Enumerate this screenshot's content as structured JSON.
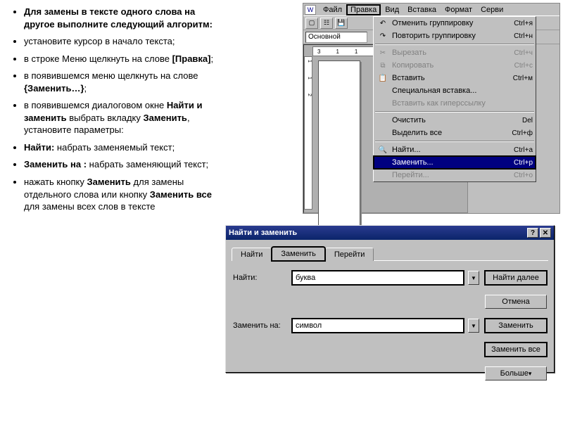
{
  "text": {
    "heading": "Для замены в тексте одного слова на другое выполните следующий алгоритм:",
    "li1": "установите курсор в начало текста;",
    "li2a": "в строке Меню щелкнуть на слове ",
    "li2b": "[Правка]",
    "li2c": ";",
    "li3a": "в появившемся меню щелкнуть на слове ",
    "li3b": "{Заменить…}",
    "li3c": ";",
    "li4a": "в появившемся диалоговом окне ",
    "li4b": "Найти и заменить",
    "li4c": " выбрать вкладку ",
    "li4d": "Заменить",
    "li4e": ", установите параметры:",
    "li5a": "Найти:",
    "li5b": " набрать заменяемый текст;",
    "li6a": "Заменить на :",
    "li6b": " набрать заменяющий текст;",
    "li7a": "нажать кнопку ",
    "li7b": "Заменить",
    "li7c": " для замены отдельного слова или кнопку ",
    "li7d": "Заменить все",
    "li7e": " для замены всех слов в тексте"
  },
  "menubar": {
    "items": [
      "Файл",
      "Правка",
      "Вид",
      "Вставка",
      "Формат",
      "Серви"
    ]
  },
  "toolbar": {
    "style_combo": "Основной",
    "ruler_ticks_h": [
      "3",
      "1",
      "1"
    ],
    "ruler_ticks_v": [
      "1",
      "1",
      "2"
    ]
  },
  "dropdown": {
    "rows": [
      {
        "icon": "↶",
        "label": "Отменить группировку",
        "shortcut": "Ctrl+я"
      },
      {
        "icon": "↷",
        "label": "Повторить группировку",
        "shortcut": "Ctrl+н"
      },
      {
        "sep": true
      },
      {
        "icon": "✂",
        "label": "Вырезать",
        "shortcut": "Ctrl+ч",
        "disabled": true
      },
      {
        "icon": "⧉",
        "label": "Копировать",
        "shortcut": "Ctrl+с",
        "disabled": true
      },
      {
        "icon": "📋",
        "label": "Вставить",
        "shortcut": "Ctrl+м"
      },
      {
        "icon": "",
        "label": "Специальная вставка...",
        "shortcut": ""
      },
      {
        "icon": "",
        "label": "Вставить как гиперссылку",
        "shortcut": "",
        "disabled": true
      },
      {
        "sep": true
      },
      {
        "icon": "",
        "label": "Очистить",
        "shortcut": "Del"
      },
      {
        "icon": "",
        "label": "Выделить все",
        "shortcut": "Ctrl+ф"
      },
      {
        "sep": true
      },
      {
        "icon": "🔍",
        "label": "Найти...",
        "shortcut": "Ctrl+а"
      },
      {
        "icon": "",
        "label": "Заменить...",
        "shortcut": "Ctrl+р",
        "highlight": true
      },
      {
        "icon": "",
        "label": "Перейти...",
        "shortcut": "Ctrl+о",
        "disabled": true
      }
    ]
  },
  "dialog": {
    "title": "Найти и заменить",
    "tabs": [
      "Найти",
      "Заменить",
      "Перейти"
    ],
    "find_label": "Найти:",
    "find_value": "буква",
    "replace_label": "Заменить на:",
    "replace_value": "символ",
    "btn_find_next": "Найти далее",
    "btn_cancel": "Отмена",
    "btn_replace": "Заменить",
    "btn_replace_all": "Заменить все",
    "btn_more": "Больше"
  }
}
